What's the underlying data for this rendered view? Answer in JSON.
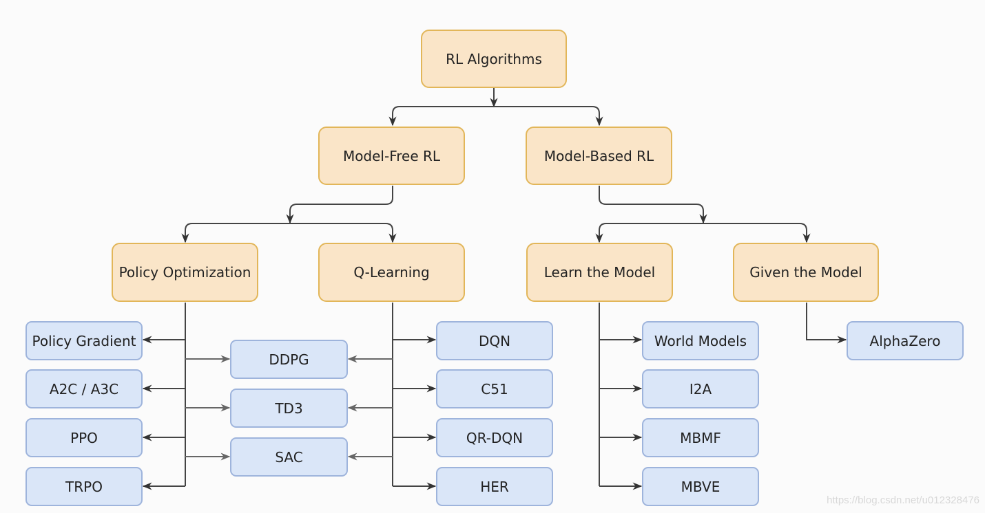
{
  "diagram": {
    "root": "RL Algorithms",
    "level1": [
      "Model-Free RL",
      "Model-Based RL"
    ],
    "level2": [
      "Policy Optimization",
      "Q-Learning",
      "Learn the Model",
      "Given the Model"
    ],
    "policy_optimization": [
      "Policy Gradient",
      "A2C / A3C",
      "PPO",
      "TRPO"
    ],
    "shared": [
      "DDPG",
      "TD3",
      "SAC"
    ],
    "q_learning": [
      "DQN",
      "C51",
      "QR-DQN",
      "HER"
    ],
    "learn_the_model": [
      "World Models",
      "I2A",
      "MBMF",
      "MBVE"
    ],
    "given_the_model": [
      "AlphaZero"
    ]
  },
  "colors": {
    "category_fill": "#fae5c8",
    "category_border": "#e2b659",
    "algorithm_fill": "#dae6f8",
    "algorithm_border": "#9eb4dc",
    "edge": "#333333"
  },
  "watermark": "https://blog.csdn.net/u012328476"
}
